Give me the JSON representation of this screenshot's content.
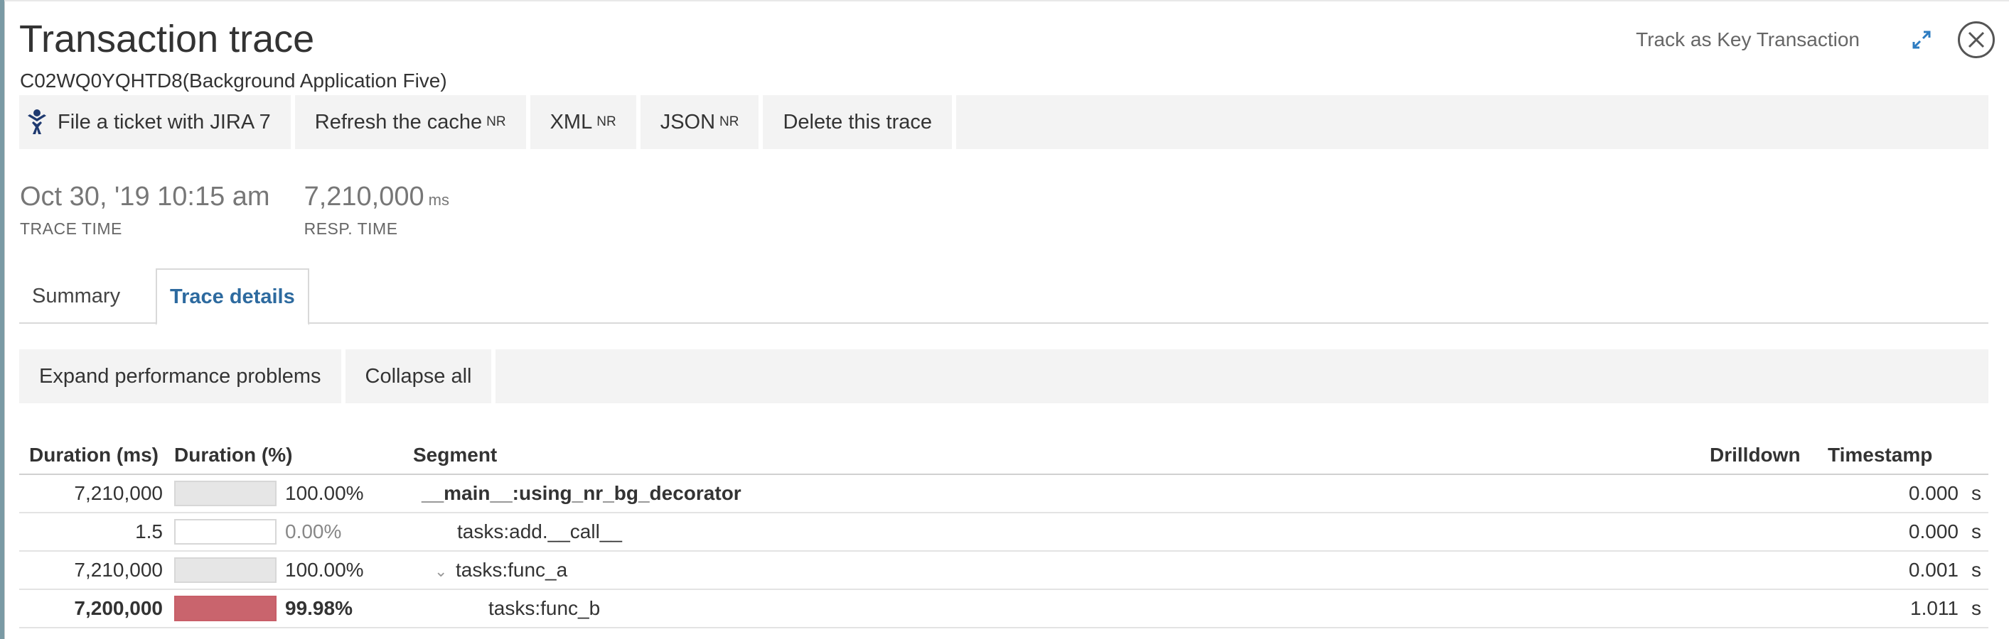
{
  "header": {
    "title": "Transaction trace",
    "subtitle": "C02WQ0YQHTD8(Background Application Five)",
    "key_transaction_link": "Track as Key Transaction",
    "icons": {
      "expand": "expand-arrows-icon",
      "close": "close-icon"
    }
  },
  "toolbar": {
    "jira": {
      "label": "File a ticket with JIRA 7",
      "icon": "jira-icon"
    },
    "refresh": {
      "label": "Refresh the cache",
      "sup": "NR"
    },
    "xml": {
      "label": "XML",
      "sup": "NR"
    },
    "json": {
      "label": "JSON",
      "sup": "NR"
    },
    "delete": {
      "label": "Delete this trace"
    }
  },
  "metrics": {
    "trace_time": {
      "value": "Oct 30, '19 10:15 am",
      "label": "TRACE TIME"
    },
    "resp_time": {
      "value": "7,210,000",
      "unit": "ms",
      "label": "RESP. TIME"
    }
  },
  "tabs": [
    {
      "label": "Summary",
      "active": false
    },
    {
      "label": "Trace details",
      "active": true
    }
  ],
  "actions": {
    "expand": "Expand performance problems",
    "collapse": "Collapse all"
  },
  "table": {
    "headers": {
      "duration_ms": "Duration (ms)",
      "duration_pct": "Duration (%)",
      "segment": "Segment",
      "drilldown": "Drilldown",
      "timestamp": "Timestamp"
    },
    "rows": [
      {
        "ms": "7,210,000",
        "pct": "100.00%",
        "pct_fill": 1.0,
        "segment": "__main__:using_nr_bg_decorator",
        "timestamp": "0.000",
        "ts_unit": "s"
      },
      {
        "ms": "1.5",
        "pct": "0.00%",
        "pct_fill": 0.0,
        "segment": "tasks:add.__call__",
        "timestamp": "0.000",
        "ts_unit": "s"
      },
      {
        "ms": "7,210,000",
        "pct": "100.00%",
        "pct_fill": 1.0,
        "segment": "tasks:func_a",
        "timestamp": "0.001",
        "ts_unit": "s"
      },
      {
        "ms": "7,200,000",
        "pct": "99.98%",
        "pct_fill": 0.9998,
        "segment": "tasks:func_b",
        "timestamp": "1.011",
        "ts_unit": "s"
      }
    ]
  },
  "colors": {
    "accent": "#2d6a9f",
    "problem": "#c9646d",
    "bar_fill": "#e6e6e6"
  }
}
